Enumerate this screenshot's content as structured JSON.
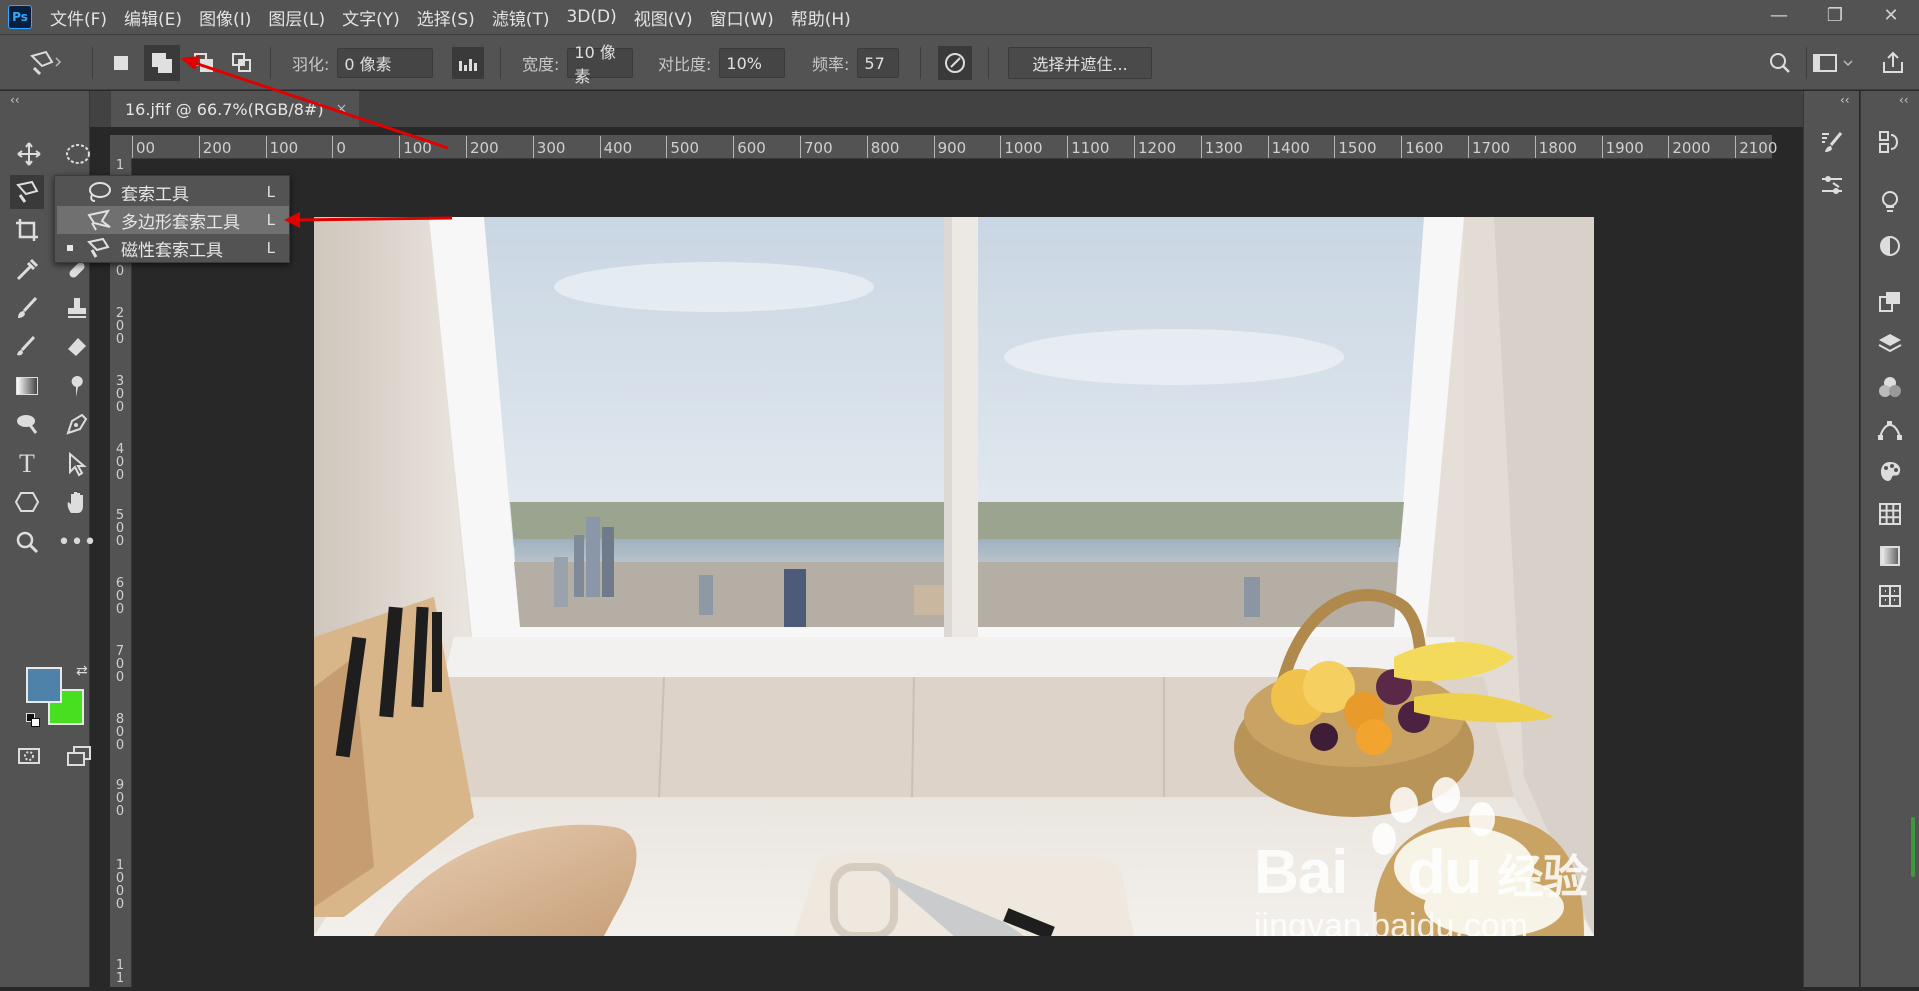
{
  "app": {
    "logo": "Ps",
    "menu": [
      "文件(F)",
      "编辑(E)",
      "图像(I)",
      "图层(L)",
      "文字(Y)",
      "选择(S)",
      "滤镜(T)",
      "3D(D)",
      "视图(V)",
      "窗口(W)",
      "帮助(H)"
    ],
    "window_controls": [
      "—",
      "❐",
      "✕"
    ]
  },
  "options": {
    "feather_label": "羽化:",
    "feather_value": "0 像素",
    "width_label": "宽度:",
    "width_value": "10 像素",
    "contrast_label": "对比度:",
    "contrast_value": "10%",
    "frequency_label": "频率:",
    "frequency_value": "57",
    "select_mask_button": "选择并遮住..."
  },
  "document": {
    "tab_title": "16.jfif @ 66.7%(RGB/8#)",
    "close": "×"
  },
  "ruler": {
    "horizontal": [
      "00",
      "200",
      "100",
      "0",
      "100",
      "200",
      "300",
      "400",
      "500",
      "600",
      "700",
      "800",
      "900",
      "1000",
      "1100",
      "1200",
      "1300",
      "1400",
      "1500",
      "1600",
      "1700",
      "1800",
      "1900",
      "2000",
      "2100"
    ],
    "vertical": [
      "1",
      "0",
      "1\n0\n0",
      "2\n0\n0",
      "3\n0\n0",
      "4\n0\n0",
      "5\n0\n0",
      "6\n0\n0",
      "7\n0\n0",
      "8\n0\n0",
      "9\n0\n0",
      "1\n0\n0\n0",
      "1\n1"
    ]
  },
  "flyout": {
    "items": [
      {
        "label": "套索工具",
        "shortcut": "L",
        "icon": "lasso-icon",
        "highlighted": false,
        "current": false
      },
      {
        "label": "多边形套索工具",
        "shortcut": "L",
        "icon": "polygonal-lasso-icon",
        "highlighted": true,
        "current": false
      },
      {
        "label": "磁性套索工具",
        "shortcut": "L",
        "icon": "magnetic-lasso-icon",
        "highlighted": false,
        "current": true
      }
    ]
  },
  "colors": {
    "foreground": "#4f82a8",
    "background": "#47e020",
    "annotation_arrow": "#e00000",
    "watermark": "#ffffff"
  },
  "watermark": {
    "brand": "Bai",
    "brand2": "du",
    "suffix": "经验",
    "url": "jingyan.baidu.com"
  }
}
